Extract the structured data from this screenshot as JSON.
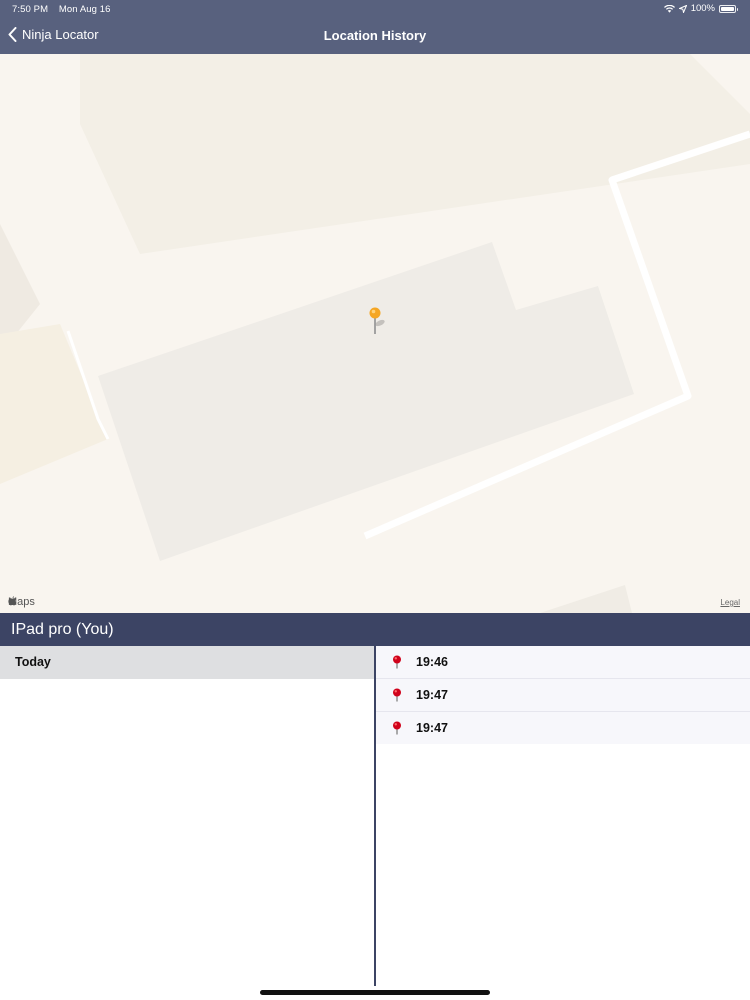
{
  "status_bar": {
    "time": "7:50 PM",
    "date": "Mon Aug 16",
    "battery": "100%"
  },
  "nav": {
    "back_label": "Ninja Locator",
    "title": "Location History"
  },
  "map": {
    "logo": "Maps",
    "legal": "Legal"
  },
  "device": {
    "name": "IPad pro (You)"
  },
  "days": [
    {
      "label": "Today"
    }
  ],
  "entries": [
    {
      "time": "19:46"
    },
    {
      "time": "19:47"
    },
    {
      "time": "19:47"
    }
  ],
  "colors": {
    "nav_bg": "#58617e",
    "header_bg": "#3c4464",
    "pin": "#f5a623",
    "list_pin": "#d0021b"
  }
}
